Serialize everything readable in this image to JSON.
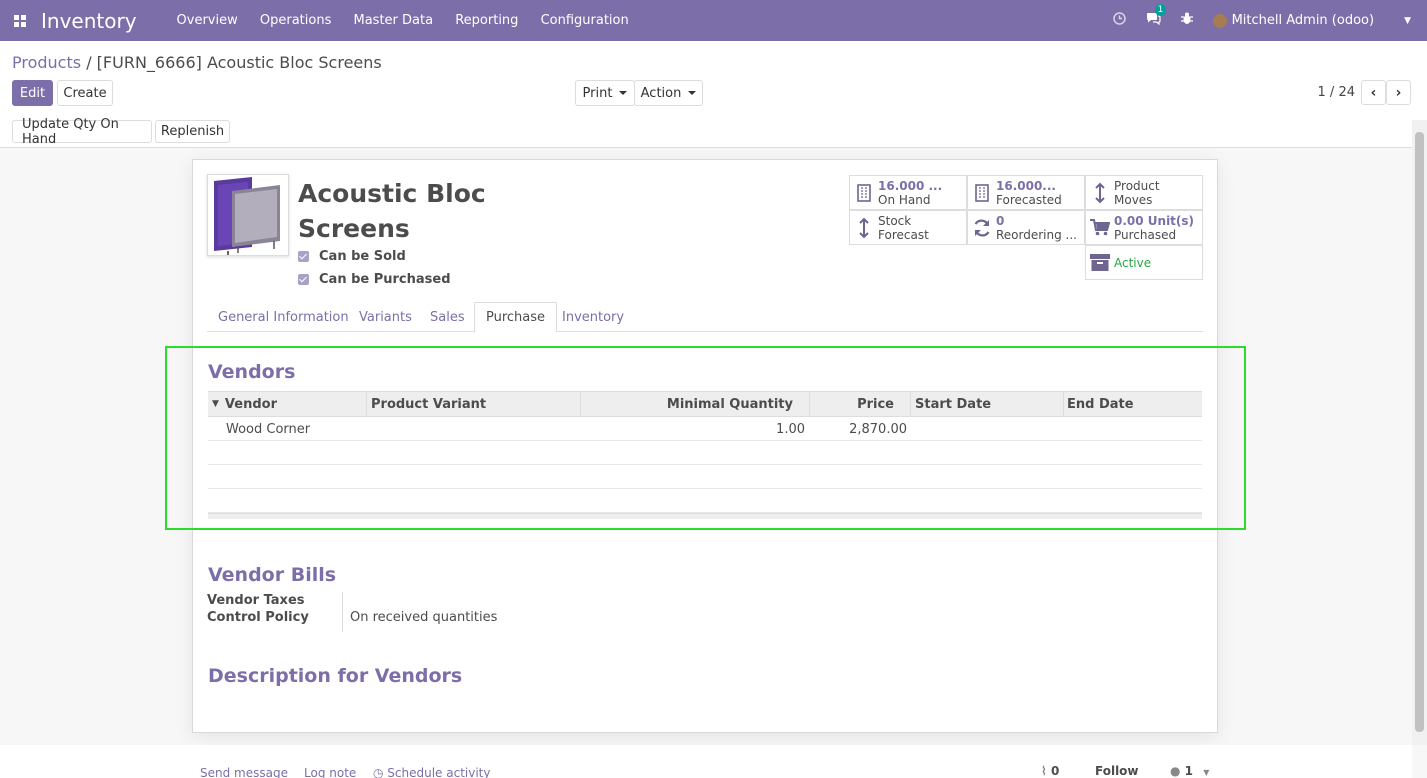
{
  "navbar": {
    "app_name": "Inventory",
    "menu": [
      "Overview",
      "Operations",
      "Master Data",
      "Reporting",
      "Configuration"
    ],
    "messages_count": "1",
    "user": "Mitchell Admin (odoo)"
  },
  "breadcrumb": {
    "parent": "Products",
    "separator": "/",
    "current": "[FURN_6666] Acoustic Bloc Screens"
  },
  "toolbar": {
    "edit": "Edit",
    "create": "Create",
    "print": "Print",
    "action": "Action",
    "pager": "1 / 24",
    "update_qty": "Update Qty On Hand",
    "replenish": "Replenish"
  },
  "product": {
    "title_line1": "Acoustic Bloc",
    "title_line2": "Screens",
    "can_be_sold": "Can be Sold",
    "can_be_purchased": "Can be Purchased"
  },
  "smart_buttons": {
    "on_hand_value": "16.000 ...",
    "on_hand_label": "On Hand",
    "forecasted_value": "16.000...",
    "forecasted_label": "Forecasted",
    "product_moves_line1": "Product",
    "product_moves_line2": "Moves",
    "stock_forecast_line1": "Stock",
    "stock_forecast_line2": "Forecast",
    "reordering_value": "0",
    "reordering_label": "Reordering ...",
    "purchased_value": "0.00 Unit(s)",
    "purchased_label": "Purchased",
    "active": "Active"
  },
  "tabs": [
    "General Information",
    "Variants",
    "Sales",
    "Purchase",
    "Inventory"
  ],
  "vendors": {
    "heading": "Vendors",
    "columns": [
      "Vendor",
      "Product Variant",
      "Minimal Quantity",
      "Price",
      "Start Date",
      "End Date"
    ],
    "rows": [
      {
        "vendor": "Wood Corner",
        "variant": "",
        "min_qty": "1.00",
        "price": "2,870.00",
        "start": "",
        "end": ""
      }
    ]
  },
  "vendor_bills": {
    "heading": "Vendor Bills",
    "label_line1": "Vendor Taxes",
    "label_line2": "Control Policy",
    "value": "On received quantities"
  },
  "description": {
    "heading": "Description for Vendors"
  },
  "chatter": {
    "send_message": "Send message",
    "log_note": "Log note",
    "schedule_activity": "Schedule activity",
    "attachments": "0",
    "follow": "Follow",
    "followers": "1"
  },
  "colors": {
    "brand": "#7c6fa9",
    "highlight": "#2bdc2b",
    "active": "#28a745"
  }
}
